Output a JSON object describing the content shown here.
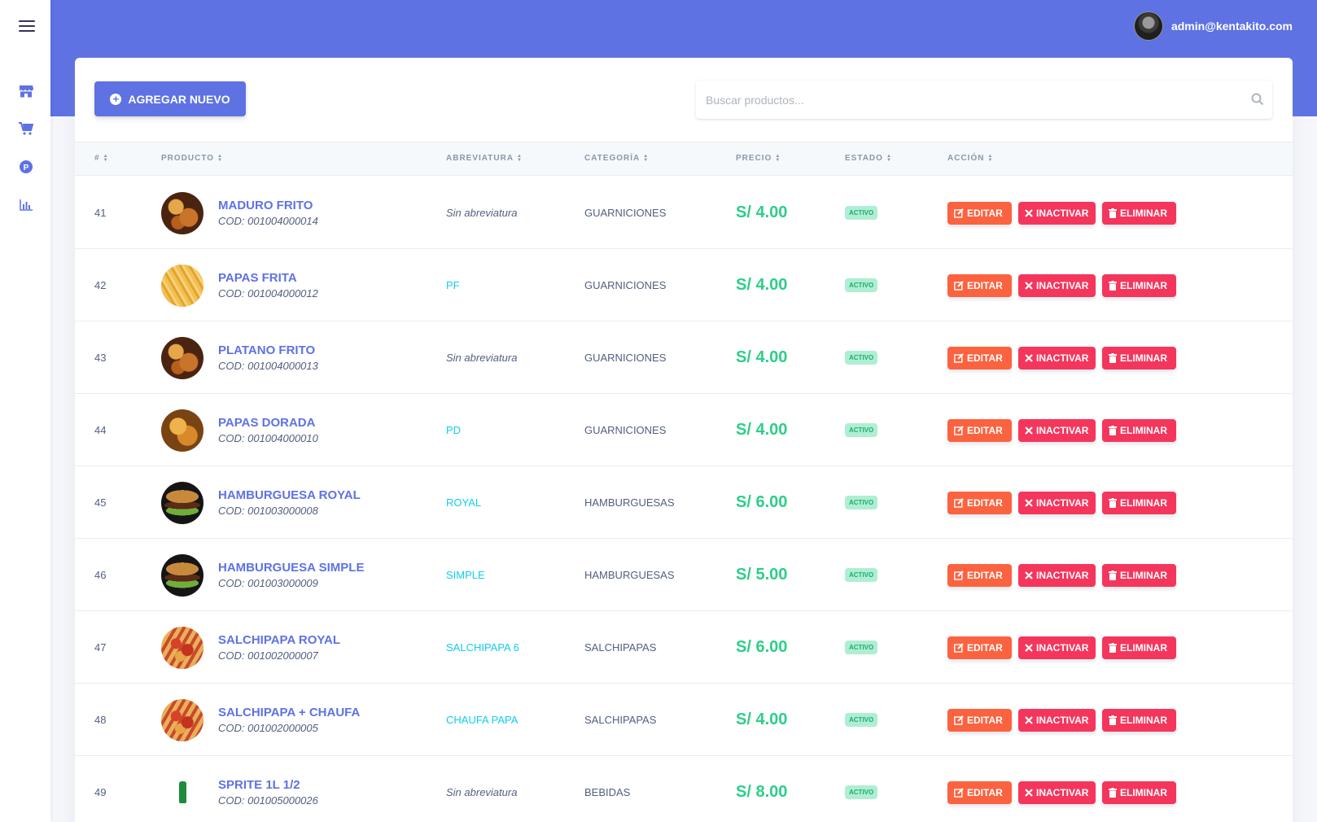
{
  "user": {
    "email": "admin@kentakito.com"
  },
  "sidebar": {
    "icons": [
      "menu-icon",
      "store-icon",
      "cart-icon",
      "parking-icon",
      "chart-icon"
    ]
  },
  "toolbar": {
    "add_label": "AGREGAR NUEVO",
    "search_placeholder": "Buscar productos..."
  },
  "table": {
    "headers": [
      "#",
      "PRODUCTO",
      "ABREVIATURA",
      "CATEGORÍA",
      "PRECIO",
      "ESTADO",
      "ACCIÓN"
    ],
    "action_labels": {
      "edit": "EDITAR",
      "inactivate": "INACTIVAR",
      "delete": "ELIMINAR"
    },
    "rows": [
      {
        "num": "41",
        "name": "MADURO FRITO",
        "code": "COD: 001004000014",
        "abbr": "Sin abreviatura",
        "abbr_empty": true,
        "category": "GUARNICIONES",
        "price": "S/ 4.00",
        "status": "ACTIVO",
        "thumb": "fried"
      },
      {
        "num": "42",
        "name": "PAPAS FRITA",
        "code": "COD: 001004000012",
        "abbr": "PF",
        "abbr_empty": false,
        "category": "GUARNICIONES",
        "price": "S/ 4.00",
        "status": "ACTIVO",
        "thumb": "fries"
      },
      {
        "num": "43",
        "name": "PLATANO FRITO",
        "code": "COD: 001004000013",
        "abbr": "Sin abreviatura",
        "abbr_empty": true,
        "category": "GUARNICIONES",
        "price": "S/ 4.00",
        "status": "ACTIVO",
        "thumb": "fried"
      },
      {
        "num": "44",
        "name": "PAPAS DORADA",
        "code": "COD: 001004000010",
        "abbr": "PD",
        "abbr_empty": false,
        "category": "GUARNICIONES",
        "price": "S/ 4.00",
        "status": "ACTIVO",
        "thumb": "golden"
      },
      {
        "num": "45",
        "name": "HAMBURGUESA ROYAL",
        "code": "COD: 001003000008",
        "abbr": "ROYAL",
        "abbr_empty": false,
        "category": "HAMBURGUESAS",
        "price": "S/ 6.00",
        "status": "ACTIVO",
        "thumb": "burger"
      },
      {
        "num": "46",
        "name": "HAMBURGUESA SIMPLE",
        "code": "COD: 001003000009",
        "abbr": "SIMPLE",
        "abbr_empty": false,
        "category": "HAMBURGUESAS",
        "price": "S/ 5.00",
        "status": "ACTIVO",
        "thumb": "burger"
      },
      {
        "num": "47",
        "name": "SALCHIPAPA ROYAL",
        "code": "COD: 001002000007",
        "abbr": "SALCHIPAPA 6",
        "abbr_empty": false,
        "category": "SALCHIPAPAS",
        "price": "S/ 6.00",
        "status": "ACTIVO",
        "thumb": "salchi"
      },
      {
        "num": "48",
        "name": "SALCHIPAPA + CHAUFA",
        "code": "COD: 001002000005",
        "abbr": "CHAUFA PAPA",
        "abbr_empty": false,
        "category": "SALCHIPAPAS",
        "price": "S/ 4.00",
        "status": "ACTIVO",
        "thumb": "salchi"
      },
      {
        "num": "49",
        "name": "SPRITE 1L 1/2",
        "code": "COD: 001005000026",
        "abbr": "Sin abreviatura",
        "abbr_empty": true,
        "category": "BEBIDAS",
        "price": "S/ 8.00",
        "status": "ACTIVO",
        "thumb": "bottle"
      }
    ]
  },
  "colors": {
    "primary": "#5e72e4",
    "success": "#2dce89",
    "warning": "#fb6340",
    "danger": "#f5365c",
    "info": "#11cdef"
  }
}
